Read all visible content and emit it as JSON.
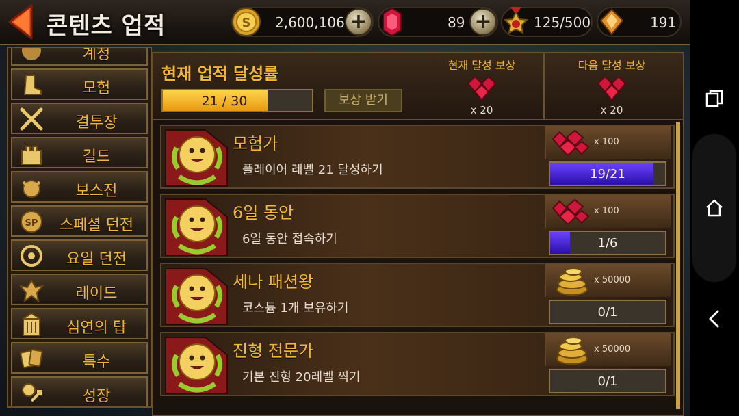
{
  "header": {
    "title": "콘텐츠 업적"
  },
  "resources": {
    "gold": "2,600,106",
    "gems": "89",
    "medals": "125/500",
    "crystals": "191"
  },
  "side_menu": [
    {
      "label": "계정",
      "icon": "account-icon"
    },
    {
      "label": "모험",
      "icon": "boot-icon"
    },
    {
      "label": "결투장",
      "icon": "crossed-swords-icon"
    },
    {
      "label": "길드",
      "icon": "castle-icon"
    },
    {
      "label": "보스전",
      "icon": "boss-icon"
    },
    {
      "label": "스페셜 던전",
      "icon": "special-dungeon-icon"
    },
    {
      "label": "요일 던전",
      "icon": "swirl-icon"
    },
    {
      "label": "레이드",
      "icon": "dragon-icon"
    },
    {
      "label": "심연의 탑",
      "icon": "tower-icon"
    },
    {
      "label": "특수",
      "icon": "cards-icon"
    },
    {
      "label": "성장",
      "icon": "growth-icon"
    }
  ],
  "summary": {
    "title": "현재 업적 달성률",
    "progress_text": "21 / 30",
    "progress_fraction": 0.7,
    "claim_label": "보상 받기",
    "current_reward_label": "현재 달성 보상",
    "current_reward_count": "x 20",
    "next_reward_label": "다음 달성 보상",
    "next_reward_count": "x 20"
  },
  "achievements": [
    {
      "title": "모험가",
      "desc": "플레이어 레벨 21 달성하기",
      "reward_type": "gem",
      "reward_amount": "x 100",
      "progress_text": "19/21",
      "progress_fraction": 0.9
    },
    {
      "title": "6일 동안",
      "desc": "6일 동안 접속하기",
      "reward_type": "gem",
      "reward_amount": "x 100",
      "progress_text": "1/6",
      "progress_fraction": 0.17
    },
    {
      "title": "세나 패션왕",
      "desc": "코스튬 1개 보유하기",
      "reward_type": "gold",
      "reward_amount": "x 50000",
      "progress_text": "0/1",
      "progress_fraction": 0
    },
    {
      "title": "진형 전문가",
      "desc": "기본 진형 20레벨 찍기",
      "reward_type": "gold",
      "reward_amount": "x 50000",
      "progress_text": "0/1",
      "progress_fraction": 0
    }
  ],
  "colors": {
    "accent": "#f2b733",
    "progress_gold": "#ffd34a",
    "progress_purple": "#4a2be0",
    "panel": "#1a120c"
  },
  "android_nav": [
    "recent-apps-icon",
    "home-icon",
    "back-icon"
  ]
}
